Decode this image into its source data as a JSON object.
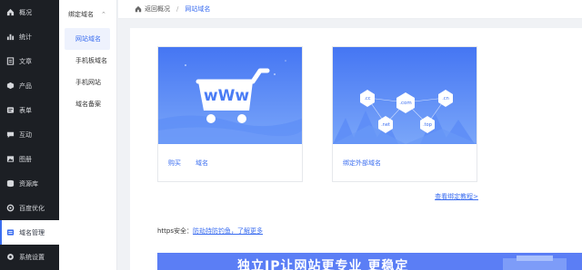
{
  "sidebar": {
    "items": [
      {
        "label": "概况",
        "icon": "home-icon"
      },
      {
        "label": "统计",
        "icon": "chart-icon"
      },
      {
        "label": "文章",
        "icon": "document-icon"
      },
      {
        "label": "产品",
        "icon": "box-icon"
      },
      {
        "label": "表单",
        "icon": "form-icon"
      },
      {
        "label": "互动",
        "icon": "chat-icon"
      },
      {
        "label": "图册",
        "icon": "image-icon"
      },
      {
        "label": "资源库",
        "icon": "database-icon"
      },
      {
        "label": "百度优化",
        "icon": "gear-icon"
      },
      {
        "label": "域名管理",
        "icon": "globe-icon"
      },
      {
        "label": "系统设置",
        "icon": "settings-icon"
      }
    ],
    "active_index": 9
  },
  "submenu": {
    "group_label": "绑定域名",
    "items": [
      {
        "label": "网站域名"
      },
      {
        "label": "手机板域名"
      },
      {
        "label": "手机网站"
      },
      {
        "label": "域名备案"
      }
    ],
    "active_index": 0
  },
  "breadcrumb": {
    "back_label": "返回概况",
    "separator": "/",
    "current": "网站域名"
  },
  "cards": [
    {
      "banner_text": "wWw",
      "links": [
        "购买",
        "域名"
      ]
    },
    {
      "tlds": [
        ".cc",
        ".com",
        ".cn",
        ".net",
        ".top"
      ],
      "links": [
        "绑定外部域名"
      ]
    }
  ],
  "tutorial_link": "查看绑定教程>",
  "https": {
    "label": "https安全：",
    "link": "防劫持防钓鱼，了解更多"
  },
  "promo": {
    "text": "独立IP让网站更专业 更稳定"
  },
  "colors": {
    "accent": "#3a6df0",
    "sidebar_bg": "#1c1f24",
    "banner_top": "#4a7cf5",
    "banner_bottom": "#6f9cf8"
  }
}
